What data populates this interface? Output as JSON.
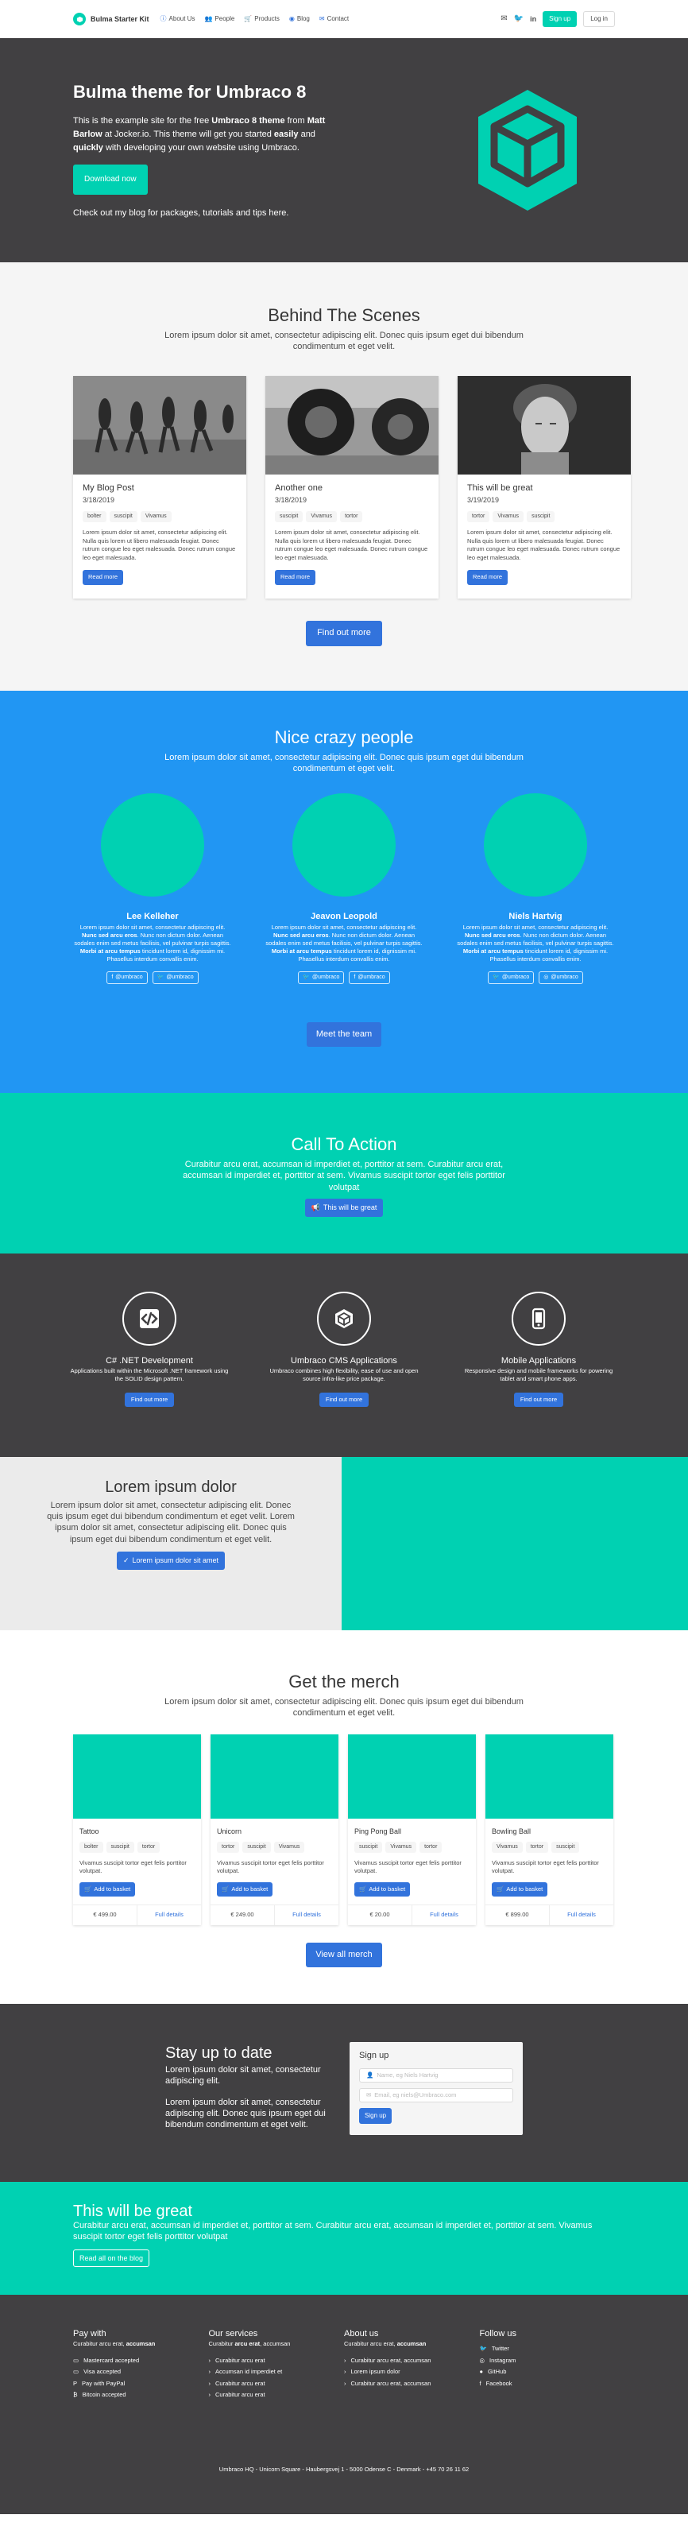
{
  "nav": {
    "brand": "Bulma Starter Kit",
    "links": [
      "About Us",
      "People",
      "Products",
      "Blog",
      "Contact"
    ],
    "signup": "Sign up",
    "login": "Log in"
  },
  "hero": {
    "title": "Bulma theme for Umbraco 8",
    "desc_1": "This is the example site for the free ",
    "desc_b1": "Umbraco 8 theme",
    "desc_2": " from ",
    "desc_b2": "Matt Barlow",
    "desc_3": " at Jocker.io. This theme will get you started ",
    "desc_b3": "easily",
    "desc_4": " and ",
    "desc_b4": "quickly",
    "desc_5": " with developing your own website using Umbraco.",
    "download": "Download now",
    "blog_line": "Check out my blog for packages, tutorials and tips here."
  },
  "behind": {
    "title": "Behind The Scenes",
    "subtitle": "Lorem ipsum dolor sit amet, consectetur adipiscing elit. Donec quis ipsum eget dui bibendum condimentum et eget velit.",
    "posts": [
      {
        "title": "My Blog Post",
        "date": "3/18/2019",
        "tags": [
          "bolter",
          "suscipit",
          "Vivamus"
        ]
      },
      {
        "title": "Another one",
        "date": "3/18/2019",
        "tags": [
          "suscipit",
          "Vivamus",
          "tortor"
        ]
      },
      {
        "title": "This will be great",
        "date": "3/19/2019",
        "tags": [
          "tortor",
          "Vivamus",
          "suscipit"
        ]
      }
    ],
    "post_text": "Lorem ipsum dolor sit amet, consectetur adipiscing elit. Nulla quis lorem ut libero malesuada feugiat. Donec rutrum congue leo eget malesuada. Donec rutrum congue leo eget malesuada.",
    "read_more": "Read more",
    "find_more": "Find out more"
  },
  "people": {
    "title": "Nice crazy people",
    "subtitle": "Lorem ipsum dolor sit amet, consectetur adipiscing elit. Donec quis ipsum eget dui bibendum condimentum et eget velit.",
    "members": [
      {
        "name": "Lee Kelleher"
      },
      {
        "name": "Jeavon Leopold"
      },
      {
        "name": "Niels Hartvig"
      }
    ],
    "bio_1": "Lorem ipsum dolor sit amet, consectetur adipiscing elit. ",
    "bio_b1": "Nunc sed arcu eros",
    "bio_2": ". Nunc non dictum dolor. Aenean sodales enim sed metus facilisis, vel pulvinar turpis sagittis. ",
    "bio_b2": "Morbi at arcu tempus",
    "bio_3": " tincidunt lorem id, dignissim mi. Phasellus interdum convallis enim.",
    "social_handle": "@umbraco",
    "team_btn": "Meet the team"
  },
  "cta": {
    "title": "Call To Action",
    "text": "Curabitur arcu erat, accumsan id imperdiet et, porttitor at sem. Curabitur arcu erat, accumsan id imperdiet et, porttitor at sem. Vivamus suscipit tortor eget felis porttitor volutpat",
    "button": "This will be great"
  },
  "services": {
    "items": [
      {
        "title": "C# .NET Development",
        "text": "Applications built within the Microsoft .NET framework using the SOLID design pattern.",
        "icon": "code-icon"
      },
      {
        "title": "Umbraco CMS Applications",
        "text": "Umbraco combines high flexibility, ease of use and open source infra-like price package.",
        "icon": "cube-icon"
      },
      {
        "title": "Mobile Applications",
        "text": "Responsive design and mobile frameworks for powering tablet and smart phone apps.",
        "icon": "mobile-icon"
      }
    ],
    "button": "Find out more"
  },
  "split": {
    "title": "Lorem ipsum dolor",
    "text": "Lorem ipsum dolor sit amet, consectetur adipiscing elit. Donec quis ipsum eget dui bibendum condimentum et eget velit. Lorem ipsum dolor sit amet, consectetur adipiscing elit. Donec quis ipsum eget dui bibendum condimentum et eget velit.",
    "button": "Lorem ipsum dolor sit amet"
  },
  "merch": {
    "title": "Get the merch",
    "subtitle": "Lorem ipsum dolor sit amet, consectetur adipiscing elit. Donec quis ipsum eget dui bibendum condimentum et eget velit.",
    "products": [
      {
        "name": "Tattoo",
        "tags": [
          "bolter",
          "suscipit",
          "tortor"
        ],
        "price": "€ 499.00"
      },
      {
        "name": "Unicorn",
        "tags": [
          "tortor",
          "suscipit",
          "Vivamus"
        ],
        "price": "€ 249.00"
      },
      {
        "name": "Ping Pong Ball",
        "tags": [
          "suscipit",
          "Vivamus",
          "tortor"
        ],
        "price": "€ 20.00"
      },
      {
        "name": "Bowling Ball",
        "tags": [
          "Vivamus",
          "tortor",
          "suscipit"
        ],
        "price": "€ 899.00"
      }
    ],
    "product_text": "Vivamus suscipit tortor eget felis porttitor volutpat.",
    "basket": "Add to basket",
    "details": "Full details",
    "view_all": "View all merch"
  },
  "stay": {
    "title": "Stay up to date",
    "p1": "Lorem ipsum dolor sit amet, consectetur adipiscing elit.",
    "p2": "Lorem ipsum dolor sit amet, consectetur adipiscing elit. Donec quis ipsum eget dui bibendum condimentum et eget velit.",
    "form_title": "Sign up",
    "name_placeholder": "Name, eg Niels Hartvig",
    "email_placeholder": "Email, eg niels@Umbraco.com",
    "button": "Sign up"
  },
  "banner": {
    "title": "This will be great",
    "text": "Curabitur arcu erat, accumsan id imperdiet et, porttitor at sem. Curabitur arcu erat, accumsan id imperdiet et, porttitor at sem. Vivamus suscipit tortor eget felis porttitor volutpat",
    "button": "Read all on the blog"
  },
  "footer": {
    "cols": [
      {
        "title": "Pay with",
        "sub_1": "Curabitur arcu erat, ",
        "sub_b": "accumsan",
        "items": [
          "Mastercard accepted",
          "Visa accepted",
          "Pay with PayPal",
          "Bitcoin accepted"
        ]
      },
      {
        "title": "Our services",
        "sub_1": "Curabitur ",
        "sub_b": "arcu erat",
        "sub_2": ", accumsan",
        "items": [
          "Curabitur arcu erat",
          "Accumsan id imperdiet et",
          "Curabitur arcu erat",
          "Curabitur arcu erat"
        ]
      },
      {
        "title": "About us",
        "sub_1": "Curabitur arcu erat, ",
        "sub_b": "accumsan",
        "items": [
          "Curabitur arcu erat, accumsan",
          "Lorem ipsum dolor",
          "Curabitur arcu erat, accumsan"
        ]
      },
      {
        "title": "Follow us",
        "items": [
          "Twitter",
          "Instagram",
          "GitHub",
          "Facebook"
        ]
      }
    ],
    "copyright": "Umbraco HQ - Unicorn Square - Haubergsvej 1 - 5000 Odense C - Denmark - +45 70 26 11 62"
  },
  "colors": {
    "primary": "#00d1b2",
    "link": "#3273dc",
    "info": "#2196f3",
    "dark": "#414042"
  }
}
